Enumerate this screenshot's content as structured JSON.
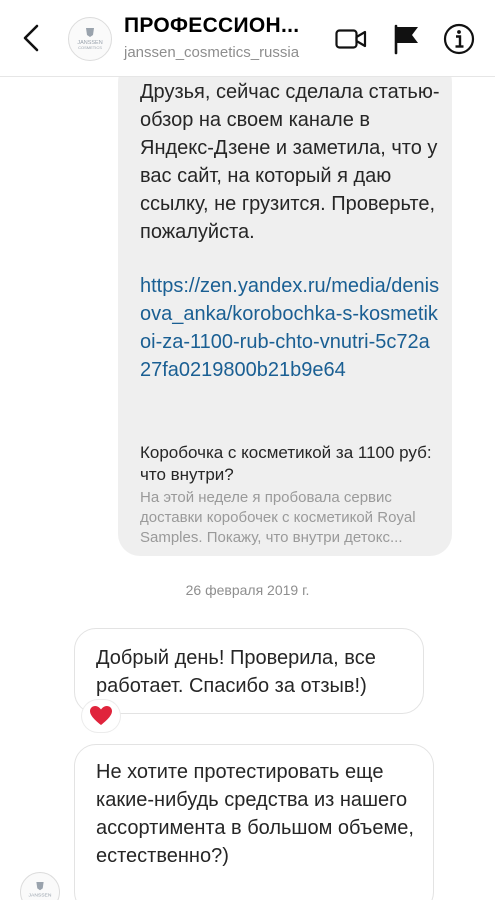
{
  "header": {
    "title": "ПРОФЕССИОН...",
    "subtitle": "janssen_cosmetics_russia",
    "avatar_text_1": "JANSSEN",
    "avatar_text_2": "COSMETICS"
  },
  "shared_post": {
    "message": "Друзья, сейчас сделала статью-обзор на своем канале в Яндекс-Дзене и заметила, что у вас сайт, на который я даю ссылку, не грузится. Проверьте, пожалуйста.",
    "link": "https://zen.yandex.ru/media/denisova_anka/korobochka-s-kosmetikoi-za-1100-rub-chto-vnutri-5c72a27fa0219800b21b9e64",
    "preview_title": "Коробочка с косметикой за 1100 руб: что внутри?",
    "preview_description": "На этой неделе я пробовала сервис доставки коробочек с косметикой Royal Samples. Покажу, что внутри детокс..."
  },
  "date_separator": "26 февраля 2019 г.",
  "messages": [
    {
      "text": "Добрый день! Проверила, все работает. Спасибо за отзыв!)"
    },
    {
      "text": "Не хотите протестировать еще какие-нибудь средства из нашего ассортимента в большом объеме, естественно?)"
    }
  ],
  "reaction": "❤️",
  "colors": {
    "link": "#1a5f93",
    "shared_bubble_bg": "#efefef",
    "meta_text": "#8e8e8e"
  },
  "icons": [
    "back-chevron-icon",
    "video-call-icon",
    "flag-icon",
    "info-icon",
    "heart-icon"
  ]
}
